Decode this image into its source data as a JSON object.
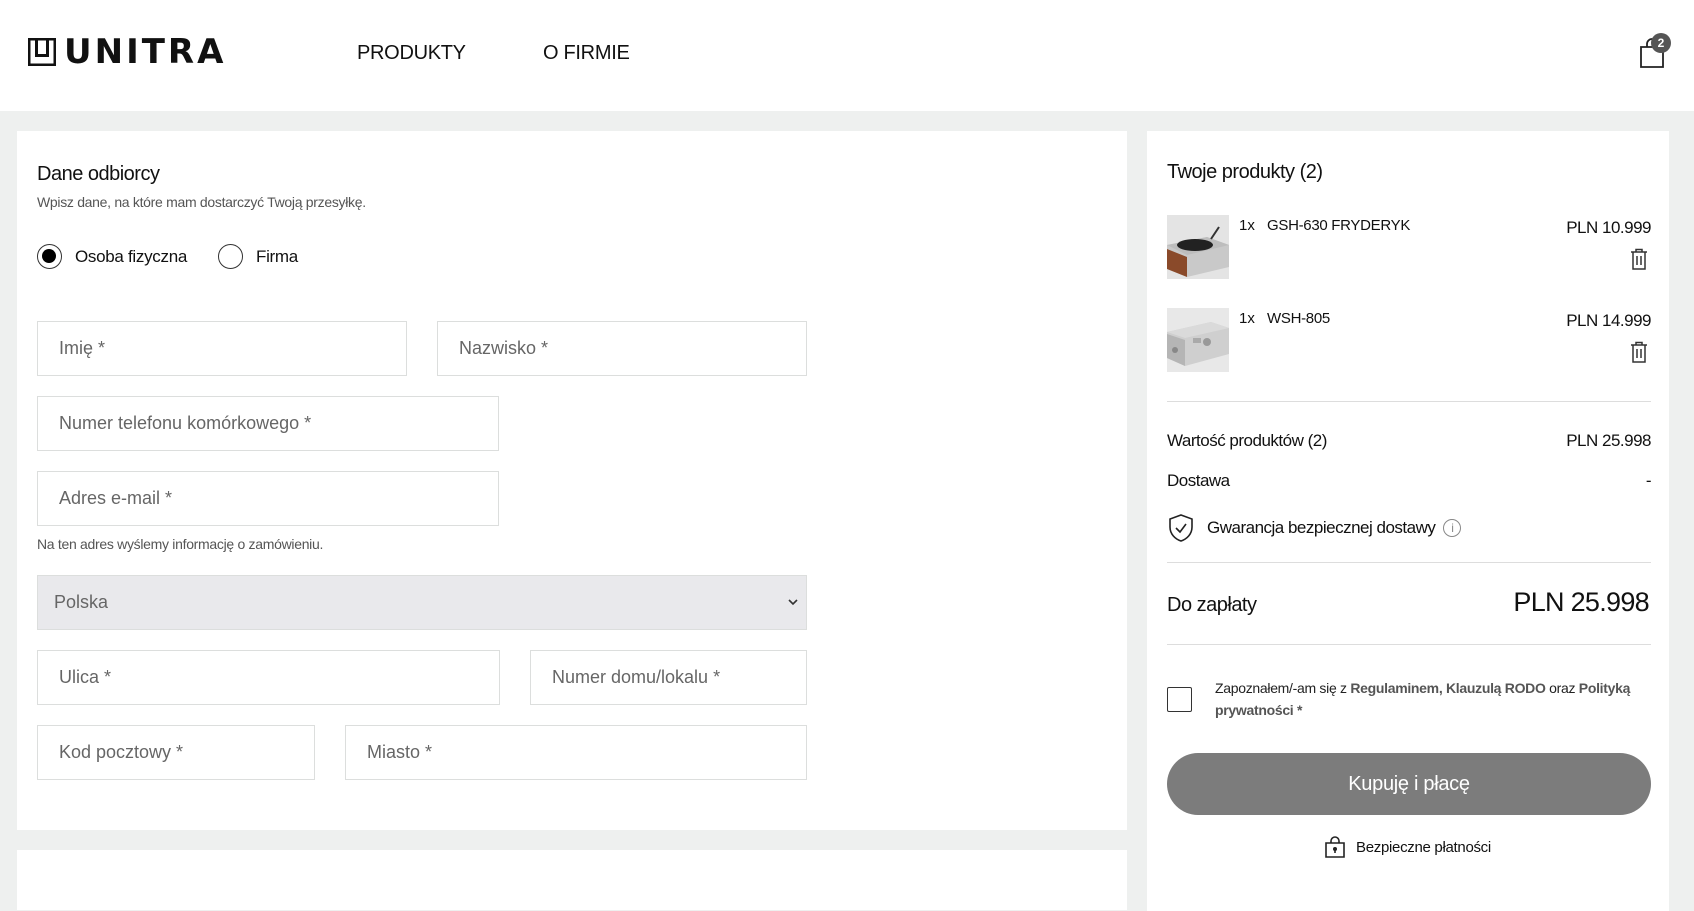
{
  "header": {
    "logo_text": "UNITRA",
    "nav": [
      "PRODUKTY",
      "O FIRMIE"
    ],
    "cart_count": "2"
  },
  "recipient": {
    "title": "Dane odbiorcy",
    "subtitle": "Wpisz dane, na które mam dostarczyć Twoją przesyłkę.",
    "types": [
      {
        "label": "Osoba fizyczna",
        "selected": true
      },
      {
        "label": "Firma",
        "selected": false
      }
    ],
    "fields": {
      "first_name": "Imię *",
      "last_name": "Nazwisko *",
      "phone": "Numer telefonu komórkowego *",
      "email": "Adres e-mail *",
      "street": "Ulica *",
      "house_number": "Numer domu/lokalu *",
      "postal_code": "Kod pocztowy *",
      "city": "Miasto *"
    },
    "email_hint": "Na ten adres wyślemy informację o zamówieniu.",
    "country": "Polska"
  },
  "summary": {
    "title": "Twoje produkty (2)",
    "products": [
      {
        "qty": "1x",
        "name": "GSH-630 FRYDERYK",
        "price": "PLN 10.999"
      },
      {
        "qty": "1x",
        "name": "WSH-805",
        "price": "PLN 14.999"
      }
    ],
    "products_value_label": "Wartość produktów (2)",
    "products_value": "PLN 25.998",
    "delivery_label": "Dostawa",
    "delivery_value": "-",
    "guarantee": "Gwarancja bezpiecznej dostawy",
    "total_label": "Do zapłaty",
    "total_value": "PLN 25.998",
    "consent": {
      "prefix": "Zapoznałem/-am się z ",
      "link1": "Regulaminem",
      "sep1": ", ",
      "link2": "Klauzulą RODO",
      "sep2": " oraz ",
      "link3": "Polityką prywatności",
      "suffix": " *"
    },
    "buy_label": "Kupuję i płacę",
    "secure_label": "Bezpieczne płatności"
  }
}
